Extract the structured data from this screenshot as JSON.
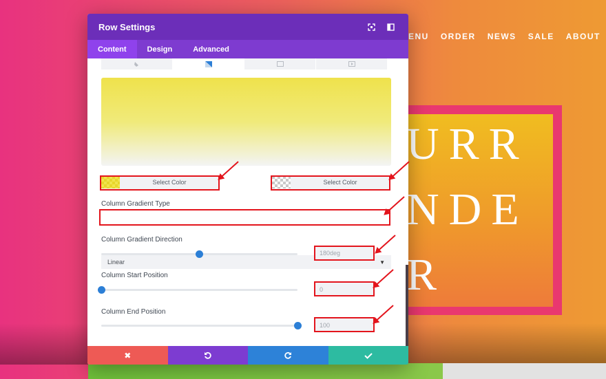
{
  "site": {
    "nav": [
      "ENU",
      "ORDER",
      "NEWS",
      "SALE",
      "ABOUT"
    ],
    "hero_lines": [
      "URR",
      "NDE",
      "R"
    ]
  },
  "panel": {
    "title": "Row Settings",
    "tabs": [
      {
        "label": "Content",
        "active": true
      },
      {
        "label": "Design",
        "active": false
      },
      {
        "label": "Advanced",
        "active": false
      }
    ],
    "gradient_preview": {
      "start_color": "#efe24c",
      "end_color": "#f3f4f4"
    },
    "color_start": {
      "label": "Select Color"
    },
    "color_end": {
      "label": "Select Color"
    },
    "gradient_type": {
      "label": "Column Gradient Type",
      "value": "Linear"
    },
    "gradient_direction": {
      "label": "Column Gradient Direction",
      "value": "180deg",
      "slider": 0.5
    },
    "start_position": {
      "label": "Column Start Position",
      "value": "0",
      "slider": 0.0
    },
    "end_position": {
      "label": "Column End Position",
      "value": "100",
      "slider": 1.0
    },
    "footer": {
      "cancel_icon": "close-icon",
      "undo_icon": "undo-icon",
      "redo_icon": "redo-icon",
      "save_icon": "check-icon"
    }
  },
  "colors": {
    "header": "#6c2eb9",
    "tabs": "#7e3bd0",
    "cancel": "#ee5a55",
    "undo": "#7d3cd1",
    "redo": "#2d82d8",
    "save": "#2dbba1",
    "annotation": "#e3141c"
  }
}
